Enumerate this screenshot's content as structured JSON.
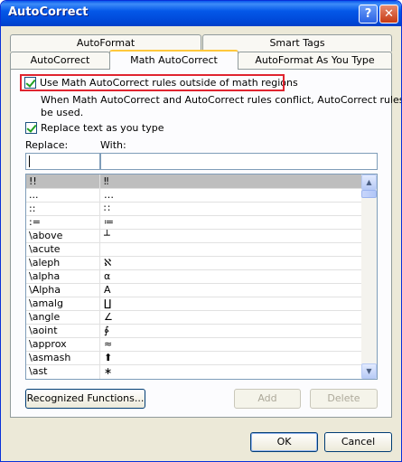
{
  "window": {
    "title": "AutoCorrect"
  },
  "titlebar": {
    "help_label": "?",
    "close_label": "✕"
  },
  "tabs": {
    "row1": [
      {
        "label": "AutoFormat"
      },
      {
        "label": "Smart Tags"
      }
    ],
    "row2": [
      {
        "label": "AutoCorrect"
      },
      {
        "label": "Math AutoCorrect"
      },
      {
        "label": "AutoFormat As You Type"
      }
    ],
    "active": "Math AutoCorrect"
  },
  "options": {
    "use_math_outside": {
      "label": "Use Math AutoCorrect rules outside of math regions",
      "checked": true
    },
    "conflict_note_line1": "When Math AutoCorrect and AutoCorrect rules conflict, AutoCorrect rules will",
    "conflict_note_line2": "be used.",
    "replace_as_you_type": {
      "label": "Replace text as you type",
      "checked": true
    }
  },
  "replace_label": "Replace:",
  "with_label": "With:",
  "replace_value": "",
  "with_value": "",
  "entries": [
    {
      "replace": "!!",
      "with": "‼"
    },
    {
      "replace": "...",
      "with": "…"
    },
    {
      "replace": "::",
      "with": "∷"
    },
    {
      "replace": ":=",
      "with": "≔"
    },
    {
      "replace": "\\above",
      "with": "┴"
    },
    {
      "replace": "\\acute",
      "with": ""
    },
    {
      "replace": "\\aleph",
      "with": "ℵ"
    },
    {
      "replace": "\\alpha",
      "with": "α"
    },
    {
      "replace": "\\Alpha",
      "with": "A"
    },
    {
      "replace": "\\amalg",
      "with": "∐"
    },
    {
      "replace": "\\angle",
      "with": "∠"
    },
    {
      "replace": "\\aoint",
      "with": "∳"
    },
    {
      "replace": "\\approx",
      "with": "≈"
    },
    {
      "replace": "\\asmash",
      "with": "⬆"
    },
    {
      "replace": "\\ast",
      "with": "∗"
    }
  ],
  "buttons": {
    "recognized_functions": "Recognized Functions...",
    "add": "Add",
    "delete": "Delete",
    "ok": "OK",
    "cancel": "Cancel"
  },
  "colors": {
    "highlight_box": "#e0242f",
    "selected_row": "#bebebe",
    "title_bar": "#0458e8"
  }
}
